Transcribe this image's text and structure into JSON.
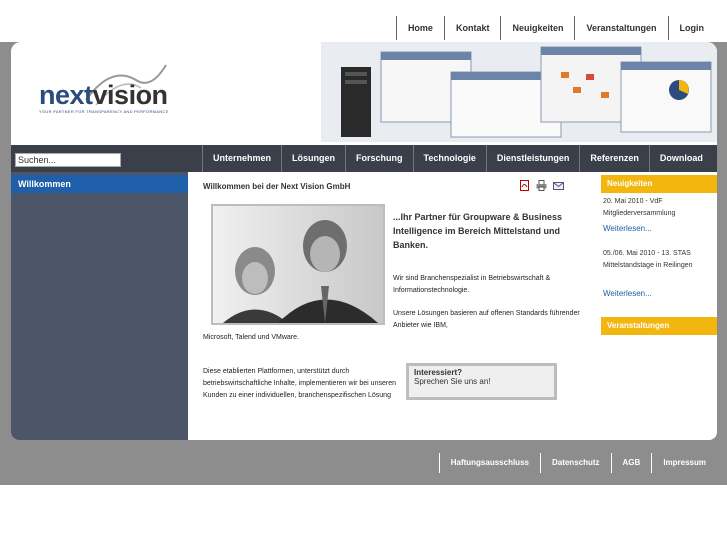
{
  "top_nav": [
    "Home",
    "Kontakt",
    "Neuigkeiten",
    "Veranstaltungen",
    "Login"
  ],
  "logo": {
    "next": "next",
    "vision": "vision",
    "tagline": "YOUR PARTNER FOR TRANSPARENCY AND PERFORMANCE"
  },
  "search": {
    "value": "Suchen..."
  },
  "main_nav": [
    "Unternehmen",
    "Lösungen",
    "Forschung",
    "Technologie",
    "Dienstleistungen",
    "Referenzen",
    "Download"
  ],
  "sidebar": {
    "heading": "Willkommen"
  },
  "content": {
    "title": "Willkommen bei der Next Vision GmbH",
    "tagline": "...Ihr Partner für Groupware & Business Intelligence im Bereich Mittelstand und Banken.",
    "p1": "Wir sind Branchenspezialist in Betriebswirtschaft & Informationstechnologie.",
    "p2": "Unsere Lösungen basieren auf offenen Standards führender Anbieter wie IBM,",
    "p3": "Microsoft, Talend und VMware.",
    "p4": "Diese etablierten Plattformen, unterstützt durch betriebswirtschaftliche Inhalte, implementieren wir bei unseren Kunden zu einer individuellen, branchenspezifischen Lösung",
    "box_title": "Interessiert?",
    "box_text": "Sprechen Sie uns an!"
  },
  "right": {
    "news_heading": "Neuigkeiten",
    "news1": "20. Mai 2010 - VdF Mitgliederversammlung",
    "news1_link": "Weiterlesen...",
    "news2": "05./06. Mai 2010 - 13. STAS Mittelstandstage in Reilingen",
    "news2_link": "Weiterlesen...",
    "events_heading": "Veranstaltungen"
  },
  "footer_nav": [
    "Haftungsausschluss",
    "Datenschutz",
    "AGB",
    "Impressum"
  ],
  "colors": {
    "accent_blue": "#1f5ea8",
    "accent_yellow": "#f2b60f",
    "nav_dark": "#3a3f4a"
  }
}
